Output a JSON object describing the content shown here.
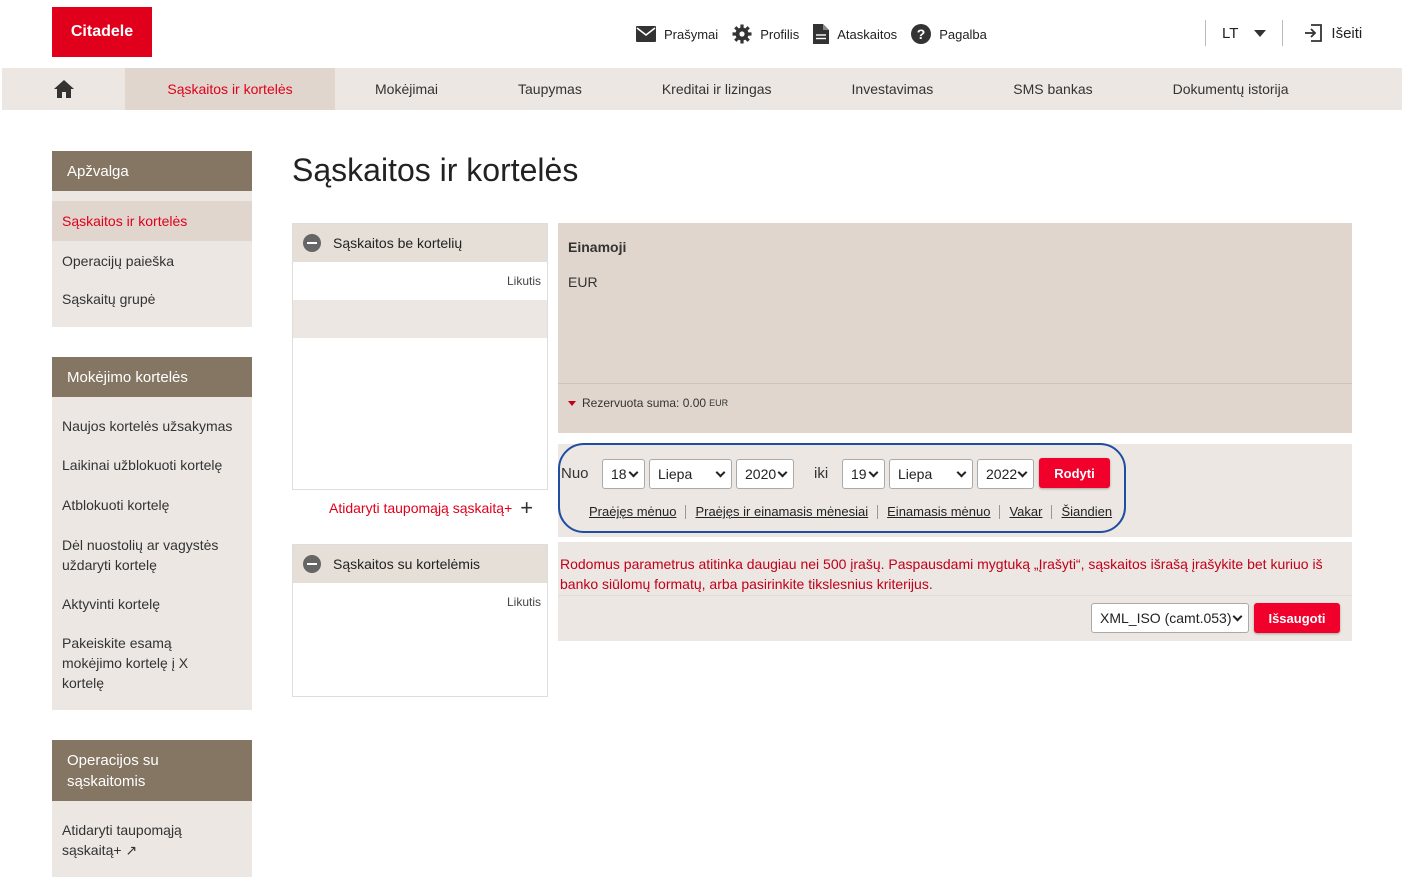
{
  "header": {
    "logo": "Citadele",
    "links": [
      {
        "label": "Prašymai",
        "icon": "envelope-icon"
      },
      {
        "label": "Profilis",
        "icon": "gear-icon"
      },
      {
        "label": "Ataskaitos",
        "icon": "document-icon"
      },
      {
        "label": "Pagalba",
        "icon": "help-icon"
      }
    ],
    "language": "LT",
    "logout": "Išeiti"
  },
  "nav": {
    "items": [
      "Sąskaitos ir kortelės",
      "Mokėjimai",
      "Taupymas",
      "Kreditai ir lizingas",
      "Investavimas",
      "SMS bankas",
      "Dokumentų istorija"
    ],
    "active_index": 0
  },
  "sidebar": {
    "sections": [
      {
        "title": "Apžvalga",
        "items": [
          "Sąskaitos ir kortelės",
          "Operacijų paieška",
          "Sąskaitų grupė"
        ]
      },
      {
        "title": "Mokėjimo kortelės",
        "items": [
          "Naujos kortelės užsakymas",
          "Laikinai užblokuoti kortelę",
          "Atblokuoti kortelę",
          "Dėl nuostolių ar vagystės uždaryti kortelę",
          "Aktyvinti kortelę",
          "Pakeiskite esamą mokėjimo kortelę į X kortelę"
        ]
      },
      {
        "title": "Operacijos su sąskaitomis",
        "items": [
          "Atidaryti taupomąją sąskaitą+ ↗"
        ]
      }
    ]
  },
  "main": {
    "title": "Sąskaitos ir kortelės",
    "panel_no_cards": {
      "title": "Sąskaitos be kortelių",
      "column": "Likutis"
    },
    "open_savings": "Atidaryti taupomąją sąskaitą+",
    "panel_with_cards": {
      "title": "Sąskaitos su kortelėmis",
      "column": "Likutis"
    },
    "account": {
      "name": "Einamoji",
      "currency": "EUR",
      "reserved_label": "Rezervuota suma:",
      "reserved_value": "0.00",
      "reserved_currency": "EUR"
    },
    "filter": {
      "from_label": "Nuo",
      "to_label": "iki",
      "from_day": "18",
      "from_month": "Liepa",
      "from_year": "2020",
      "to_day": "19",
      "to_month": "Liepa",
      "to_year": "2022",
      "show_button": "Rodyti",
      "quick_links": [
        "Praėjęs mėnuo",
        "Praėjęs ir einamasis mėnesiai",
        "Einamasis mėnuo",
        "Vakar",
        "Šiandien"
      ]
    },
    "warning": "Rodomus parametrus atitinka daugiau nei 500 įrašų. Paspausdami mygtuką „Įrašyti“, sąskaitos išrašą įrašykite bet kuriuo iš banko siūlomų formatų, arba pasirinkite tikslesnius kriterijus.",
    "export_format": "XML_ISO (camt.053)",
    "save_button": "Išsaugoti"
  },
  "colors": {
    "brand_red": "#e0001b",
    "sidebar_head": "#857563",
    "highlight": "#1e4da3"
  }
}
